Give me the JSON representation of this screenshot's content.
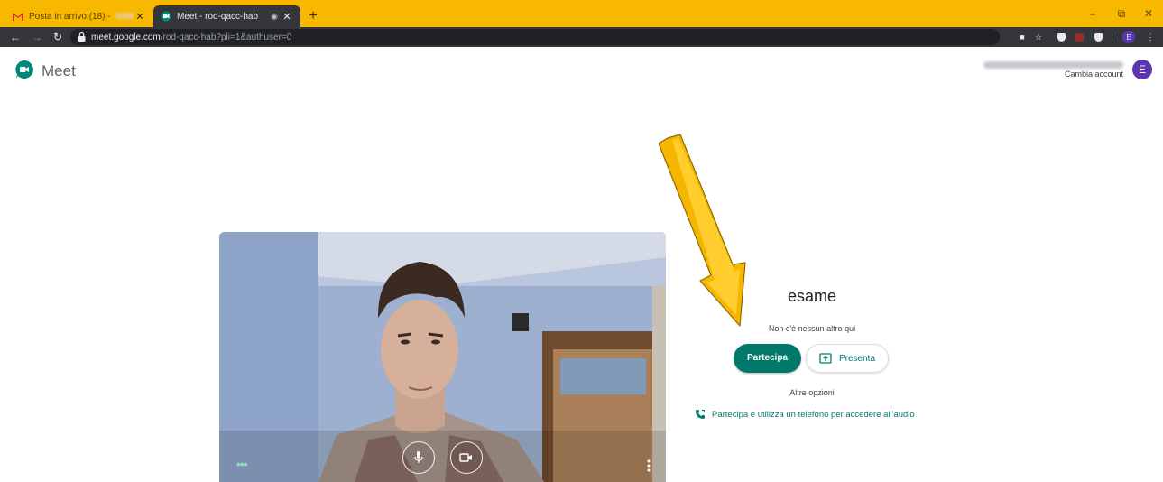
{
  "browser": {
    "tabs": [
      {
        "title": "Posta in arrivo (18) - ",
        "active": false,
        "favicon": "gmail-icon"
      },
      {
        "title": "Meet - rod-qacc-hab",
        "active": true,
        "favicon": "meet-icon"
      }
    ],
    "new_tab_symbol": "+",
    "window_controls": {
      "minimize": "–",
      "restore": "⧉",
      "close": "✕"
    },
    "url_host": "meet.google.com",
    "url_path": "/rod-qacc-hab?pli=1&authuser=0",
    "colors": {
      "titlebar": "#f9b800",
      "toolbar": "#35363a",
      "omnibox": "#202124"
    }
  },
  "header": {
    "app_name": "Meet",
    "switch_account": "Cambia account",
    "avatar_letter": "E",
    "colors": {
      "avatar": "#5e35b1"
    }
  },
  "join_panel": {
    "meeting_name": "esame",
    "status": "Non c'è nessun altro qui",
    "join_label": "Partecipa",
    "present_label": "Presenta",
    "more_options": "Altre opzioni",
    "phone_option": "Partecipa e utilizza un telefono per accedere all'audio",
    "colors": {
      "accent": "#00796b"
    }
  },
  "preview": {
    "controls": [
      "microphone-icon",
      "camera-icon"
    ],
    "more_options_icon": "more-vert-icon",
    "effects_icon": "more-horiz-icon"
  },
  "annotation": {
    "arrow_color": "#f9b800"
  }
}
